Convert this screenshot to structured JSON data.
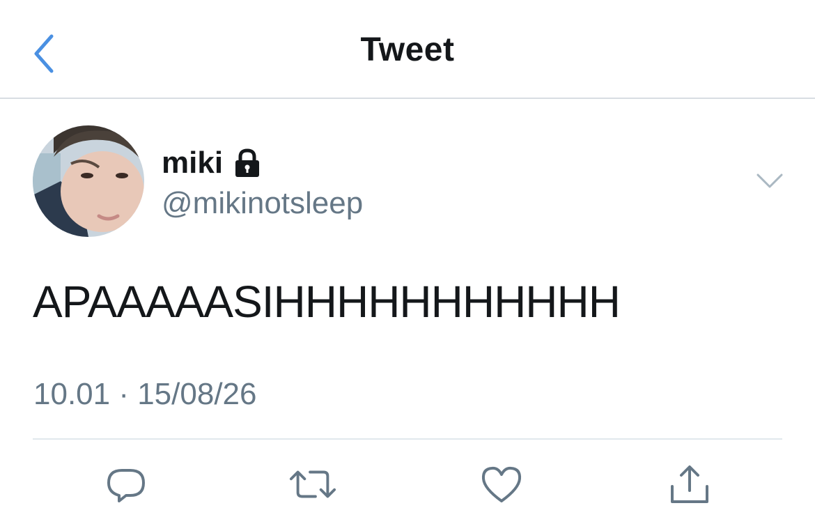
{
  "header": {
    "title": "Tweet"
  },
  "author": {
    "display_name": "miki",
    "handle": "@mikinotsleep",
    "protected": true
  },
  "tweet": {
    "text": "APAAAAASIHHHHHHHHHHH",
    "timestamp": "10.01 · 15/08/26"
  },
  "icons": {
    "back": "chevron-left-icon",
    "lock": "lock-icon",
    "more": "chevron-down-icon",
    "reply": "reply-icon",
    "retweet": "retweet-icon",
    "like": "heart-icon",
    "share": "share-icon"
  },
  "colors": {
    "accent": "#4a90e2",
    "secondary_text": "#657786",
    "icon_gray": "#657786",
    "divider": "#e1e8ed"
  }
}
